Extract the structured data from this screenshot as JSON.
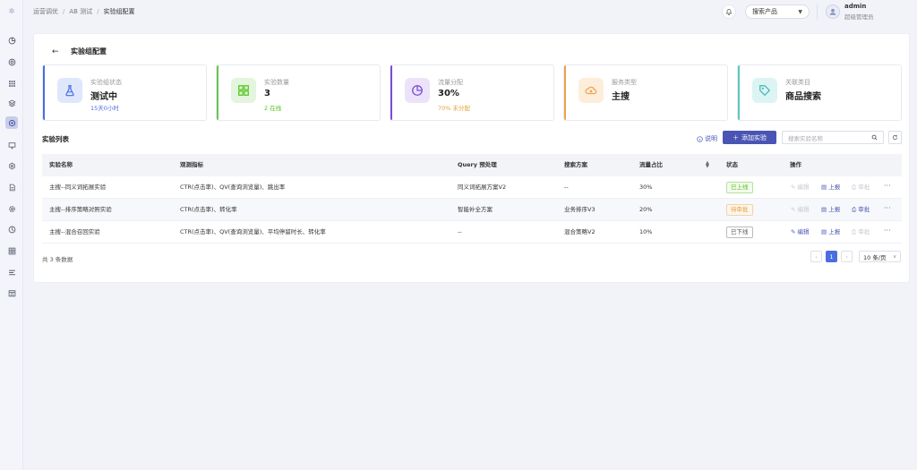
{
  "colors": {
    "primary": "#4a55b3",
    "stat_bars": [
      "#4a6ee0",
      "#6cc655",
      "#7a4fd6",
      "#f0a04b",
      "#5cc7c2"
    ],
    "status_online": "#52c41a",
    "status_pending": "#e4a13b",
    "status_offline": "#666666"
  },
  "sidebar": {
    "items": [
      {
        "icon": "pie-chart-icon"
      },
      {
        "icon": "target-icon"
      },
      {
        "icon": "grid-dots-icon"
      },
      {
        "icon": "layers-icon"
      },
      {
        "icon": "settings-gear-icon",
        "active": true
      },
      {
        "icon": "monitor-icon"
      },
      {
        "icon": "cog-icon"
      },
      {
        "icon": "document-icon"
      },
      {
        "icon": "settings-icon"
      },
      {
        "icon": "clock-icon"
      },
      {
        "icon": "table-icon"
      },
      {
        "icon": "list-icon"
      },
      {
        "icon": "calendar-grid-icon"
      }
    ]
  },
  "breadcrumb": {
    "items": [
      "运营调优",
      "AB 测试",
      "实验组配置"
    ],
    "separator": "/"
  },
  "header": {
    "product_select": "搜索产品",
    "user_name": "admin",
    "user_role": "超级管理员"
  },
  "page": {
    "title": "实验组配置"
  },
  "stats": [
    {
      "label": "实验组状态",
      "value": "测试中",
      "sub": "15天0小时",
      "sub_color": "#4a6ee0",
      "icon": "flask-icon",
      "icon_bg": "#dfe7fb",
      "icon_color": "#4a6ee0"
    },
    {
      "label": "实验数量",
      "value": "3",
      "sub": "2 在线",
      "sub_color": "#52c41a",
      "icon": "apps-grid-icon",
      "icon_bg": "#e3f5dc",
      "icon_color": "#52c41a"
    },
    {
      "label": "流量分配",
      "value": "30%",
      "sub": "70% 未分配",
      "sub_color": "#e4a13b",
      "icon": "pie-slice-icon",
      "icon_bg": "#ece3fa",
      "icon_color": "#7a4fd6"
    },
    {
      "label": "服务类型",
      "value": "主搜",
      "sub": "",
      "sub_color": "#999999",
      "icon": "cloud-eye-icon",
      "icon_bg": "#fdeedb",
      "icon_color": "#f0a04b"
    },
    {
      "label": "关联类目",
      "value": "商品搜索",
      "sub": "",
      "sub_color": "#999999",
      "icon": "tag-icon",
      "icon_bg": "#dcf4f3",
      "icon_color": "#3bb8b2"
    }
  ],
  "list": {
    "title": "实验列表",
    "help_label": "说明",
    "add_label": "添加实验",
    "search_placeholder": "搜索实验名称"
  },
  "table": {
    "headers": [
      "实验名称",
      "观测指标",
      "Query 预处理",
      "搜索方案",
      "流量占比",
      "状态",
      "操作"
    ],
    "rows": [
      {
        "name": "主搜--同义词拓展实验",
        "metrics": "CTR(点击率)、QV(查询浏览量)、跳出率",
        "query": "同义词拓展方案V2",
        "plan": "--",
        "traffic": "30%",
        "status": "已上线",
        "status_color": "#52c41a",
        "status_bg": "#f3fbef",
        "actions": {
          "edit": "编辑",
          "report": "上报",
          "approve": "审批"
        },
        "enabled": [
          false,
          true,
          false
        ]
      },
      {
        "name": "主搜--排序策略对照实验",
        "metrics": "CTR(点击率)、转化率",
        "query": "智能补全方案",
        "plan": "业务排序V3",
        "traffic": "20%",
        "status": "待审批",
        "status_color": "#e4a13b",
        "status_bg": "#fdf6ec",
        "actions": {
          "edit": "编辑",
          "report": "上报",
          "approve": "审批"
        },
        "enabled": [
          false,
          true,
          true
        ]
      },
      {
        "name": "主搜--混合召回实验",
        "metrics": "CTR(点击率)、QV(查询浏览量)、平均停留时长、转化率",
        "query": "--",
        "plan": "混合策略V2",
        "traffic": "10%",
        "status": "已下线",
        "status_color": "#555555",
        "status_bg": "#ffffff",
        "actions": {
          "edit": "编辑",
          "report": "上报",
          "approve": "审批"
        },
        "enabled": [
          true,
          true,
          false
        ]
      }
    ]
  },
  "pagination": {
    "total": "共 3 条数据",
    "current_page": "1",
    "page_size": "10 条/页"
  }
}
